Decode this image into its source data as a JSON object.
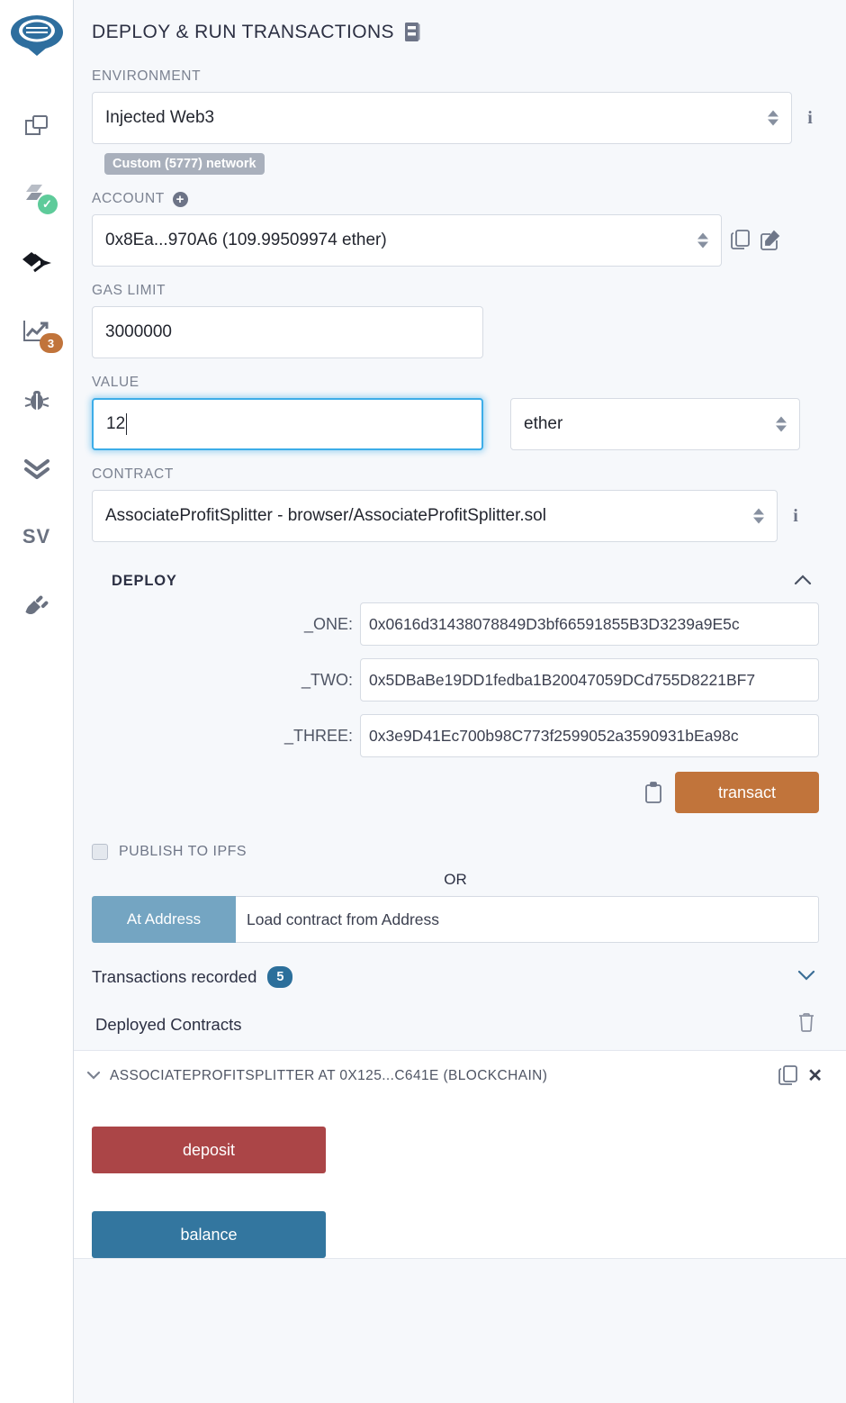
{
  "sidebar": {
    "logo_name": "remix-logo",
    "items": [
      {
        "name": "file-explorers-icon",
        "label": "File explorers"
      },
      {
        "name": "solidity-compiler-icon",
        "label": "Solidity compiler",
        "badge_check": "✓"
      },
      {
        "name": "deploy-run-transactions-icon",
        "label": "Deploy & run transactions"
      },
      {
        "name": "analysis-icon",
        "label": "Solidity static analysis",
        "badge_count": "3"
      },
      {
        "name": "debugger-icon",
        "label": "Debugger"
      },
      {
        "name": "unit-testing-icon",
        "label": "Solidity unit testing"
      },
      {
        "name": "sourcify-icon",
        "label": "SV"
      },
      {
        "name": "plugin-manager-icon",
        "label": "Plugin manager"
      }
    ]
  },
  "header": {
    "title": "DEPLOY & RUN TRANSACTIONS",
    "doc_icon": "book-icon"
  },
  "environment": {
    "label": "ENVIRONMENT",
    "value": "Injected Web3",
    "network_badge": "Custom (5777) network",
    "info_icon": "ℹ"
  },
  "account": {
    "label": "ACCOUNT",
    "value": "0x8Ea...970A6 (109.99509974 ether)",
    "add_icon": "+",
    "copy_icon": "copy-icon",
    "edit_icon": "edit-icon"
  },
  "gas_limit": {
    "label": "GAS LIMIT",
    "value": "3000000"
  },
  "value": {
    "label": "VALUE",
    "value": "12",
    "unit": "ether"
  },
  "contract": {
    "label": "CONTRACT",
    "value": "AssociateProfitSplitter - browser/AssociateProfitSplitter.sol"
  },
  "deploy": {
    "title": "DEPLOY",
    "collapse_icon": "chevron-up-icon",
    "args": [
      {
        "name": "_ONE:",
        "value": "0x0616d31438078849D3bf66591855B3D3239a9E5c"
      },
      {
        "name": "_TWO:",
        "value": "0x5DBaBe19DD1fedba1B20047059DCd755D8221BF7"
      },
      {
        "name": "_THREE:",
        "value": "0x3e9D41Ec700b98C773f2599052a3590931bEa98c"
      }
    ],
    "clipboard_icon": "clipboard-icon",
    "transact_label": "transact"
  },
  "ipfs": {
    "label": "PUBLISH TO IPFS",
    "checked": false
  },
  "or_label": "OR",
  "at_address": {
    "button_label": "At Address",
    "input_placeholder": "Load contract from Address"
  },
  "transactions_recorded": {
    "label": "Transactions recorded",
    "count": "5",
    "chevron": "chevron-down-icon"
  },
  "deployed_contracts": {
    "label": "Deployed Contracts",
    "trash_icon": "trash-icon",
    "instance": {
      "title": "ASSOCIATEPROFITSPLITTER AT 0X125...C641E (BLOCKCHAIN)",
      "expand_icon": "chevron-down-icon",
      "copy_icon": "copy-icon",
      "close_icon": "✕",
      "functions": [
        {
          "label": "deposit",
          "kind": "payable"
        },
        {
          "label": "balance",
          "kind": "view"
        }
      ]
    }
  },
  "colors": {
    "transact": "#c1743b",
    "at_address": "#74a5c2",
    "deposit": "#ab4547",
    "balance": "#33769f",
    "badge_network": "#a9b0bc",
    "pill": "#2c6f9b",
    "focus_border": "#3dade8",
    "panel_bg": "#f6f8fb"
  }
}
